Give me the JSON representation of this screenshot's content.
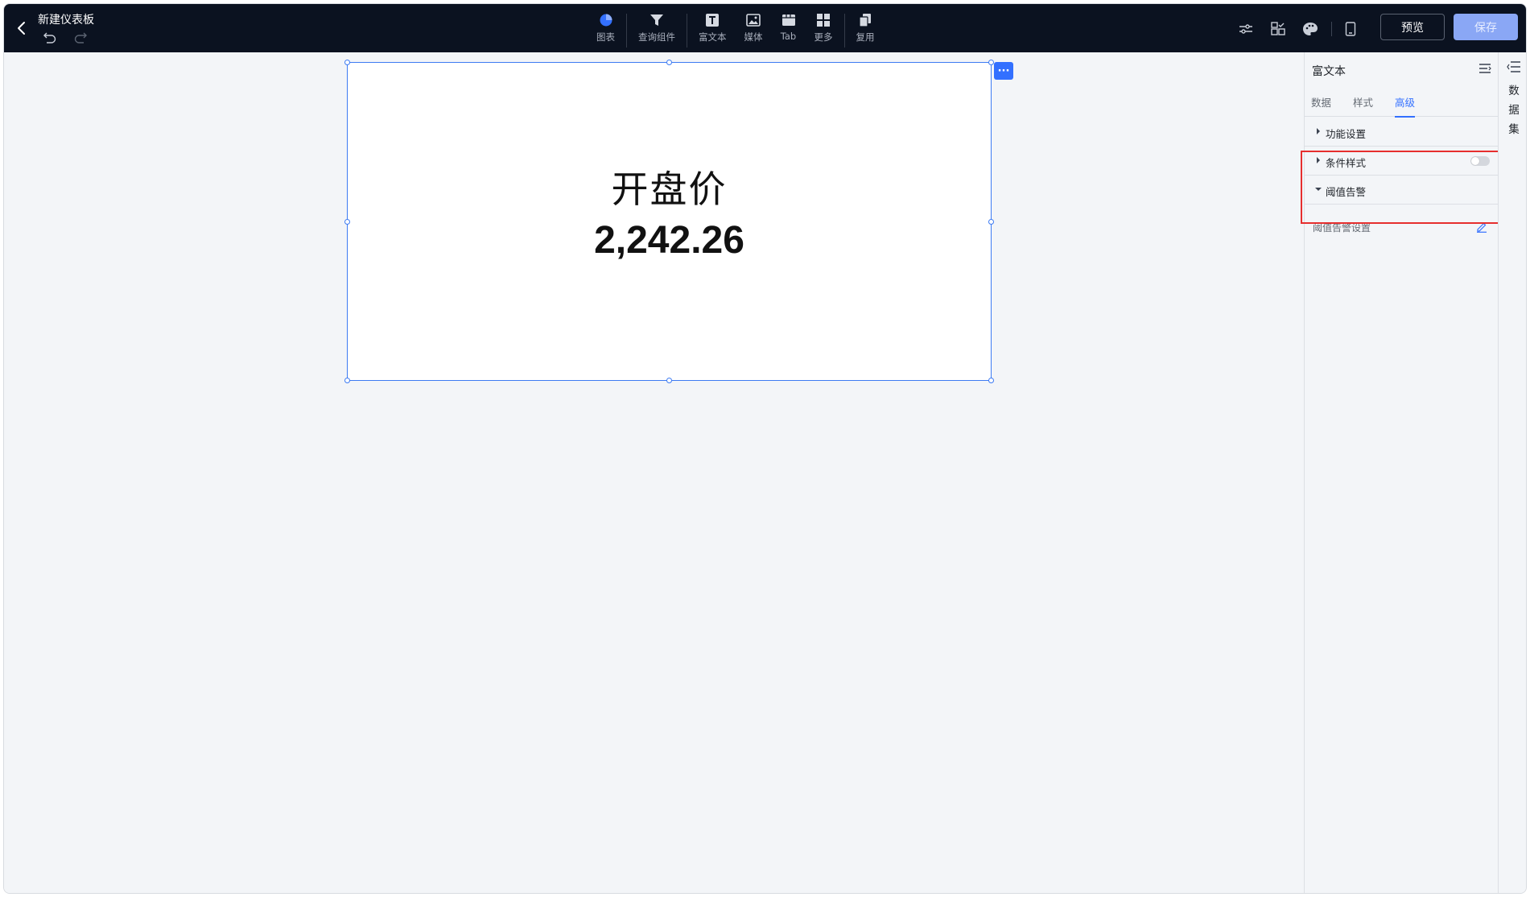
{
  "header": {
    "title": "新建仪表板",
    "toolbar": [
      {
        "label": "图表",
        "icon": "pie-chart-icon"
      },
      {
        "label": "查询组件",
        "icon": "filter-icon"
      },
      {
        "label": "富文本",
        "icon": "text-icon"
      },
      {
        "label": "媒体",
        "icon": "image-icon"
      },
      {
        "label": "Tab",
        "icon": "tab-icon"
      },
      {
        "label": "更多",
        "icon": "grid-icon"
      },
      {
        "label": "复用",
        "icon": "copy-icon"
      }
    ],
    "preview_label": "预览",
    "save_label": "保存"
  },
  "canvas": {
    "widget": {
      "title": "开盘价",
      "value": "2,242.26",
      "more_label": "···"
    }
  },
  "panel": {
    "title": "富文本",
    "tabs": [
      "数据",
      "样式",
      "高级"
    ],
    "active_tab": "高级",
    "sections": {
      "function_settings": "功能设置",
      "conditional_style": "条件样式",
      "threshold_alert": "阈值告警"
    },
    "threshold_setting_label": "阈值告警设置"
  },
  "dataset": {
    "label": "数据集"
  },
  "colors": {
    "accent": "#3370ff",
    "topbar": "#0b1220",
    "highlight": "#e62e2e"
  }
}
